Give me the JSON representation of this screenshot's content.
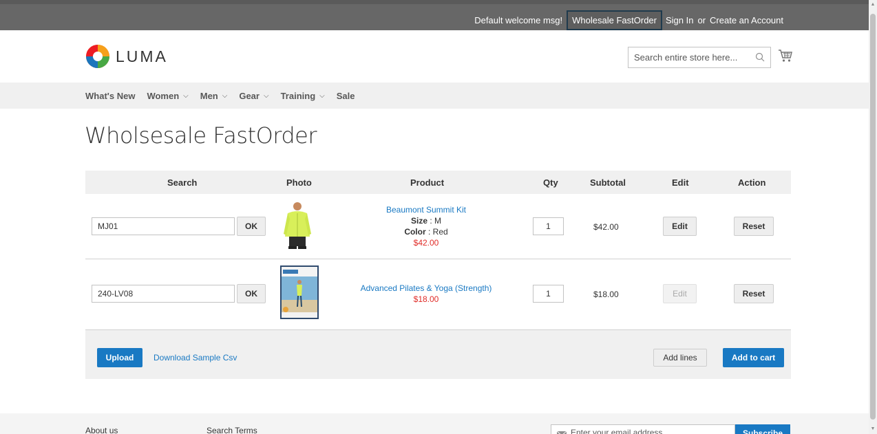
{
  "topbar": {
    "welcome": "Default welcome msg!",
    "fastorder_link": "Wholesale FastOrder",
    "sign_in": "Sign In",
    "or": "or",
    "create_account": "Create an Account"
  },
  "header": {
    "logo_text": "LUMA",
    "search_placeholder": "Search entire store here...",
    "search_icon": "search-icon",
    "cart_icon": "cart-icon"
  },
  "nav": {
    "items": [
      {
        "label": "What's New",
        "has_dropdown": false
      },
      {
        "label": "Women",
        "has_dropdown": true
      },
      {
        "label": "Men",
        "has_dropdown": true
      },
      {
        "label": "Gear",
        "has_dropdown": true
      },
      {
        "label": "Training",
        "has_dropdown": true
      },
      {
        "label": "Sale",
        "has_dropdown": false
      }
    ],
    "chevron": "⌵"
  },
  "page": {
    "title": "Wholsesale FastOrder"
  },
  "table": {
    "headers": [
      "Search",
      "Photo",
      "Product",
      "Qty",
      "Subtotal",
      "Edit",
      "Action"
    ],
    "rows": [
      {
        "sku": "MJ01",
        "ok_label": "OK",
        "product_name": "Beaumont Summit Kit",
        "size_label": "Size",
        "size_value": ": M",
        "color_label": "Color",
        "color_value": ": Red",
        "price": "$42.00",
        "qty": "1",
        "subtotal": "$42.00",
        "edit_label": "Edit",
        "edit_enabled": true,
        "reset_label": "Reset"
      },
      {
        "sku": "240-LV08",
        "ok_label": "OK",
        "product_name": "Advanced Pilates & Yoga (Strength)",
        "price": "$18.00",
        "qty": "1",
        "subtotal": "$18.00",
        "edit_label": "Edit",
        "edit_enabled": false,
        "reset_label": "Reset"
      }
    ]
  },
  "actions": {
    "upload": "Upload",
    "download_sample": "Download Sample Csv",
    "add_lines": "Add lines",
    "add_to_cart": "Add to cart"
  },
  "footer": {
    "about_us": "About us",
    "search_terms": "Search Terms",
    "newsletter_placeholder": "Enter your email address",
    "subscribe": "Subscribe"
  },
  "colors": {
    "primary_blue": "#1979c3",
    "price_red": "#e02b27",
    "topbar_gray": "#676767"
  }
}
